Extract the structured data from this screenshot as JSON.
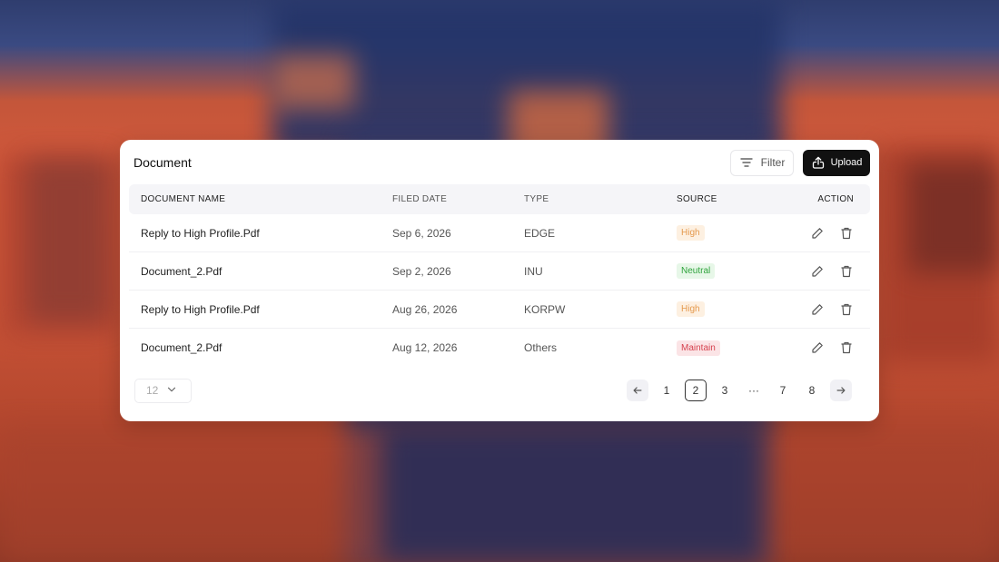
{
  "card": {
    "title": "Document",
    "filter_label": "Filter",
    "upload_label": "Upload"
  },
  "table": {
    "headers": [
      "DOCUMENT NAME",
      "FILED DATE",
      "TYPE",
      "SOURCE",
      "ACTION"
    ],
    "rows": [
      {
        "name": "Reply to High Profile.Pdf",
        "date": "Sep 6, 2026",
        "type": "EDGE",
        "source": "High"
      },
      {
        "name": "Document_2.Pdf",
        "date": "Sep 2, 2026",
        "type": "INU",
        "source": "Neutral"
      },
      {
        "name": "Reply to High Profile.Pdf",
        "date": "Aug 26, 2026",
        "type": "KORPW",
        "source": "High"
      },
      {
        "name": "Document_2.Pdf",
        "date": "Aug 12, 2026",
        "type": "Others",
        "source": "Maintain"
      }
    ]
  },
  "pagination": {
    "page_size": "12",
    "pages": [
      "1",
      "2",
      "3",
      "···",
      "7",
      "8"
    ],
    "current_page": "2"
  },
  "icons": {
    "filter": "filter-lines-icon",
    "upload": "upload-icon",
    "edit": "pencil-icon",
    "delete": "trash-icon",
    "prev": "arrow-left-icon",
    "next": "arrow-right-icon",
    "dropdown": "chevron-down-icon"
  },
  "colors": {
    "upload_bg": "#111111",
    "badge_high": "#e59a4e",
    "badge_neutral": "#2fa33c",
    "badge_maintain": "#d6424f"
  }
}
